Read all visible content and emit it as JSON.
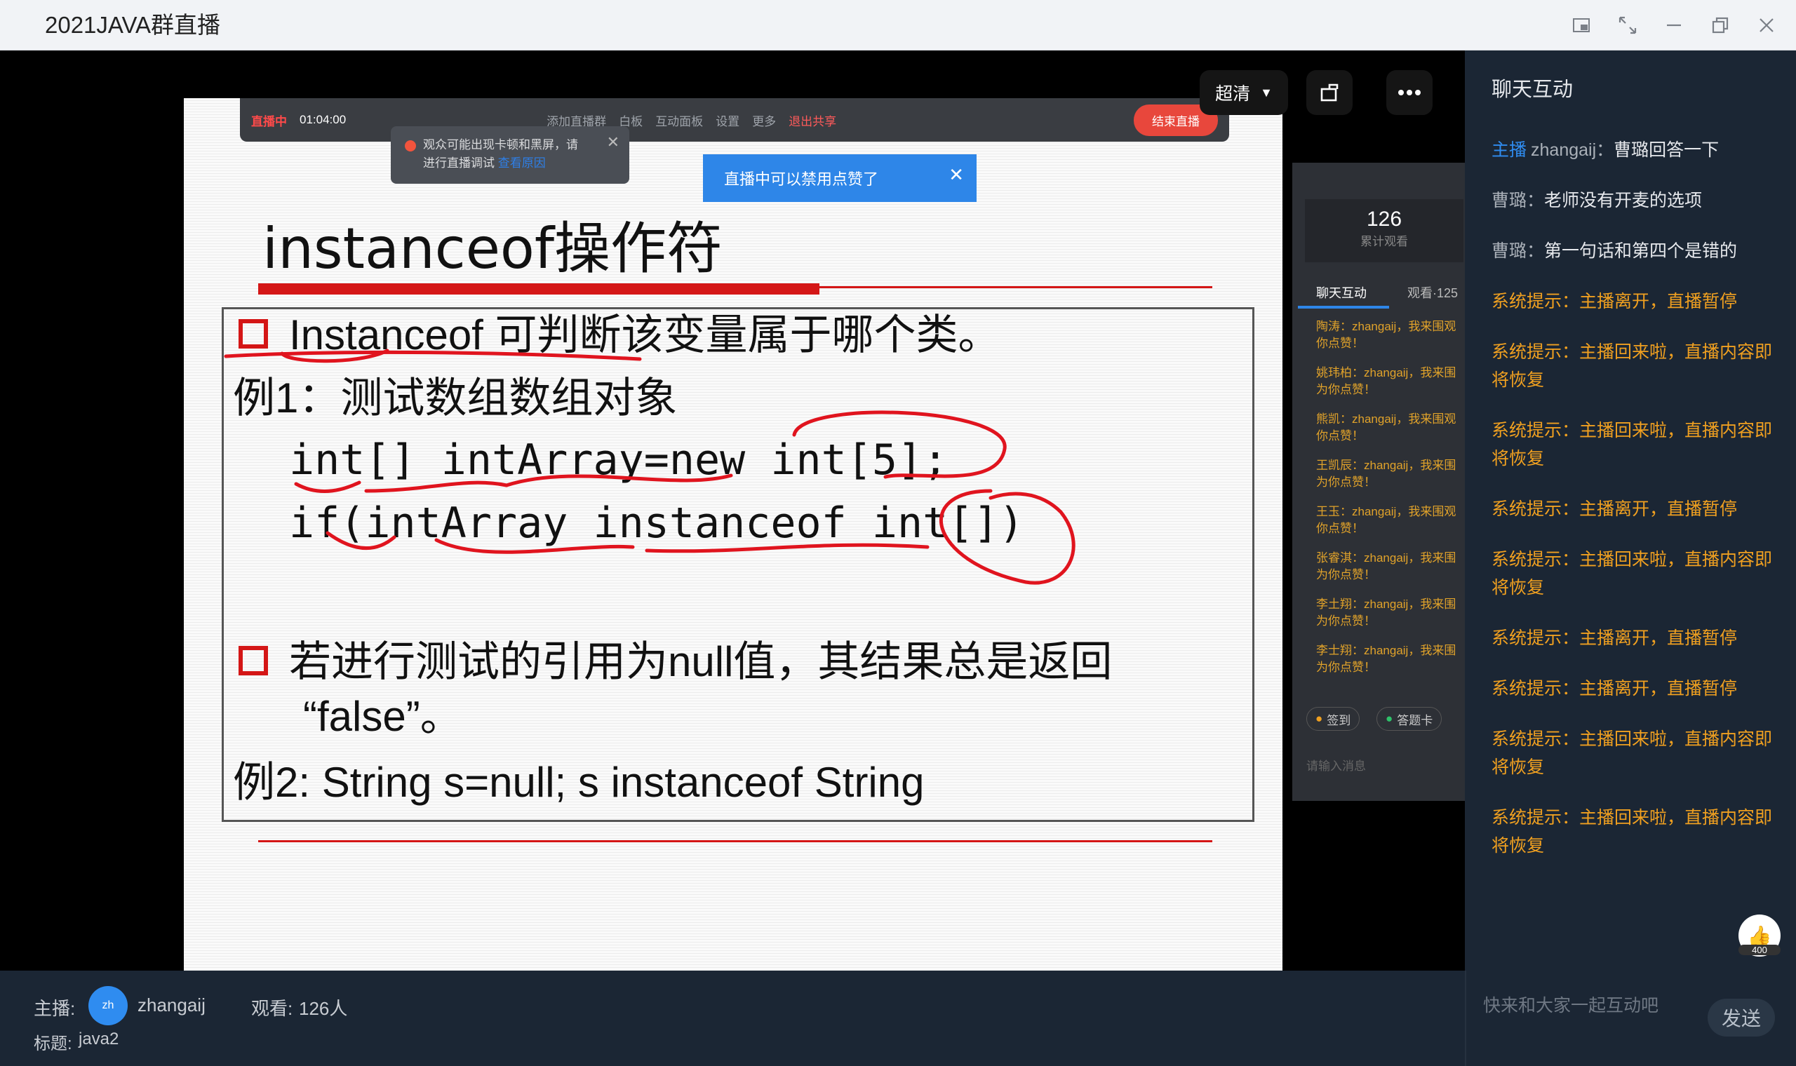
{
  "window": {
    "title": "2021JAVA群直播",
    "controls": [
      "picture-in-picture-icon",
      "fullscreen-icon",
      "minimize-icon",
      "restore-icon",
      "close-icon"
    ]
  },
  "player": {
    "quality_label": "超清",
    "rotate_icon": "rotate-icon",
    "more_icon": "more-icon"
  },
  "shared_screen": {
    "toolbar": {
      "live_label": "直播中",
      "timer": "01:04:00",
      "items": [
        "添加直播群",
        "白板",
        "互动面板",
        "设置",
        "更多",
        "退出共享"
      ],
      "end_label": "结束直播"
    },
    "warning_popup": {
      "text_line1": "观众可能出现卡顿和黑屏，请",
      "text_line2": "进行直播调试",
      "link": "查看原因"
    },
    "info_popup": "直播中可以禁用点赞了",
    "slide": {
      "heading": "instanceof操作符",
      "bullet1": "Instanceof 可判断该变量属于哪个类。",
      "example1_label": "例1：测试数组数组对象",
      "code1": "int[] intArray=new int[5];",
      "code2": "if(intArray instanceof int[])",
      "bullet2_line1": "若进行测试的引用为null值，其结果总是返回",
      "bullet2_line2": "“false”。",
      "example2": "例2:  String s=null; s instanceof String"
    },
    "viewer_panel": {
      "count": "126",
      "count_label": "累计观看",
      "tab_chat": "聊天互动",
      "tab_viewers": "观看·125",
      "messages": [
        {
          "l1": "陶涛：zhangaij，我来围观",
          "l2": "你点赞！"
        },
        {
          "l1": "姚玮柏：zhangaij，我来围",
          "l2": "为你点赞！"
        },
        {
          "l1": "熊凯：zhangaij，我来围观",
          "l2": "你点赞！"
        },
        {
          "l1": "王凯辰：zhangaij，我来围",
          "l2": "为你点赞！"
        },
        {
          "l1": "王玉：zhangaij，我来围观",
          "l2": "你点赞！"
        },
        {
          "l1": "张睿淇：zhangaij，我来围",
          "l2": "为你点赞！"
        },
        {
          "l1": "李土翔：zhangaij，我来围",
          "l2": "为你点赞！"
        },
        {
          "l1": "李士翔：zhangaij，我来围",
          "l2": "为你点赞！"
        }
      ],
      "btn_checkin": "签到",
      "btn_card": "答题卡",
      "input_placeholder": "请输入消息"
    }
  },
  "info_bar": {
    "host_label": "主播:",
    "avatar_text": "zh",
    "host_name": "zhangaij",
    "viewers_label": "观看:",
    "viewers_value": "126人",
    "title_label": "标题:",
    "title_value": "java2"
  },
  "chat": {
    "title": "聊天互动",
    "messages": [
      {
        "type": "host",
        "tag": "主播",
        "user": "zhangaij：",
        "text": "曹璐回答一下"
      },
      {
        "type": "user",
        "user": "曹璐：",
        "text": "老师没有开麦的选项"
      },
      {
        "type": "user",
        "user": "曹璐：",
        "text": "第一句话和第四个是错的"
      },
      {
        "type": "system",
        "text": "系统提示：主播离开，直播暂停"
      },
      {
        "type": "system",
        "text": "系统提示：主播回来啦，直播内容即将恢复"
      },
      {
        "type": "system",
        "text": "系统提示：主播回来啦，直播内容即将恢复"
      },
      {
        "type": "system",
        "text": "系统提示：主播离开，直播暂停"
      },
      {
        "type": "system",
        "text": "系统提示：主播回来啦，直播内容即将恢复"
      },
      {
        "type": "system",
        "text": "系统提示：主播离开，直播暂停"
      },
      {
        "type": "system",
        "text": "系统提示：主播离开，直播暂停"
      },
      {
        "type": "system",
        "text": "系统提示：主播回来啦，直播内容即将恢复"
      },
      {
        "type": "system",
        "text": "系统提示：主播回来啦，直播内容即将恢复"
      }
    ],
    "like_count": "400",
    "input_placeholder": "快来和大家一起互动吧",
    "send_label": "发送"
  }
}
